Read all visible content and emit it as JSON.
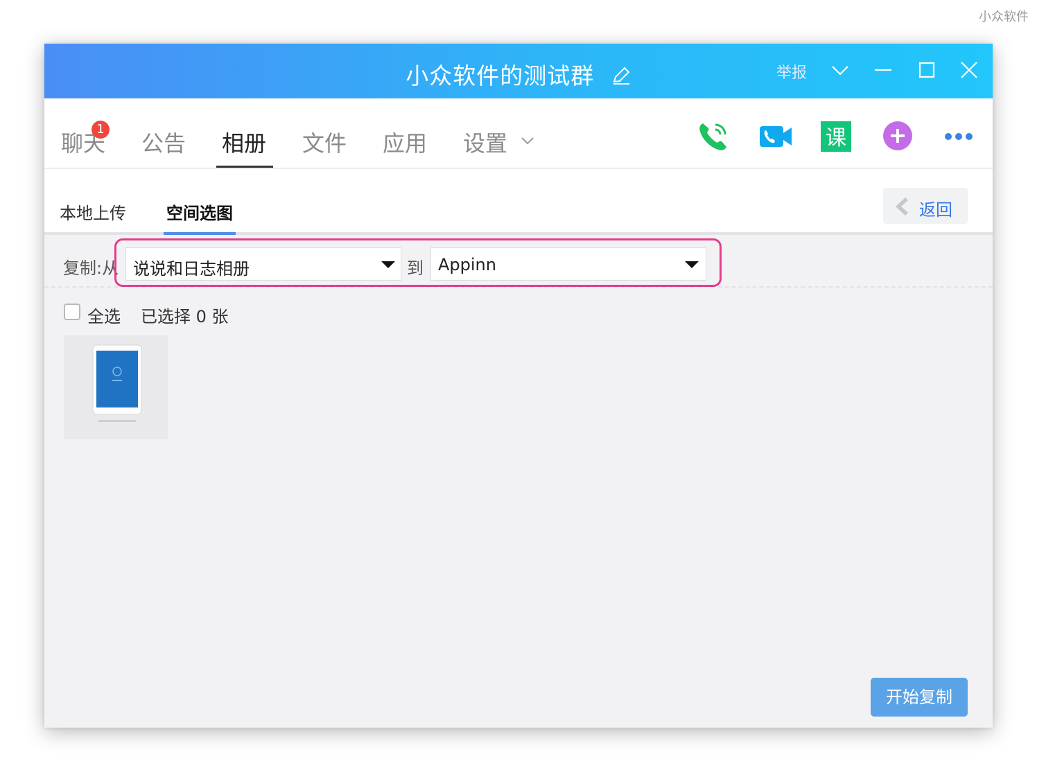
{
  "watermark": "小众软件",
  "window": {
    "title": "小众软件的测试群",
    "report_label": "举报"
  },
  "nav": {
    "tabs": [
      {
        "label": "聊天",
        "badge": "1"
      },
      {
        "label": "公告"
      },
      {
        "label": "相册",
        "active": true
      },
      {
        "label": "文件"
      },
      {
        "label": "应用"
      },
      {
        "label": "设置"
      }
    ],
    "icons": [
      "phone-call-icon",
      "video-call-icon",
      "class-icon",
      "add-app-icon",
      "more-icon"
    ],
    "class_icon_glyph": "课"
  },
  "subnav": {
    "tabs": [
      "本地上传",
      "空间选图"
    ],
    "active": "空间选图",
    "back_label": "返回"
  },
  "copy": {
    "from_label": "复制:从",
    "from_value": "说说和日志相册",
    "to_label": "到",
    "to_value": "Appinn"
  },
  "selection": {
    "select_all_label": "全选",
    "selected_count": "已选择 0 张"
  },
  "start_button": "开始复制",
  "colors": {
    "title_gradient_start": "#4a8ef5",
    "title_gradient_end": "#22c6fb",
    "highlight": "#e23d8a",
    "primary_button": "#5aa3e6",
    "accent_blue": "#3478e5"
  }
}
